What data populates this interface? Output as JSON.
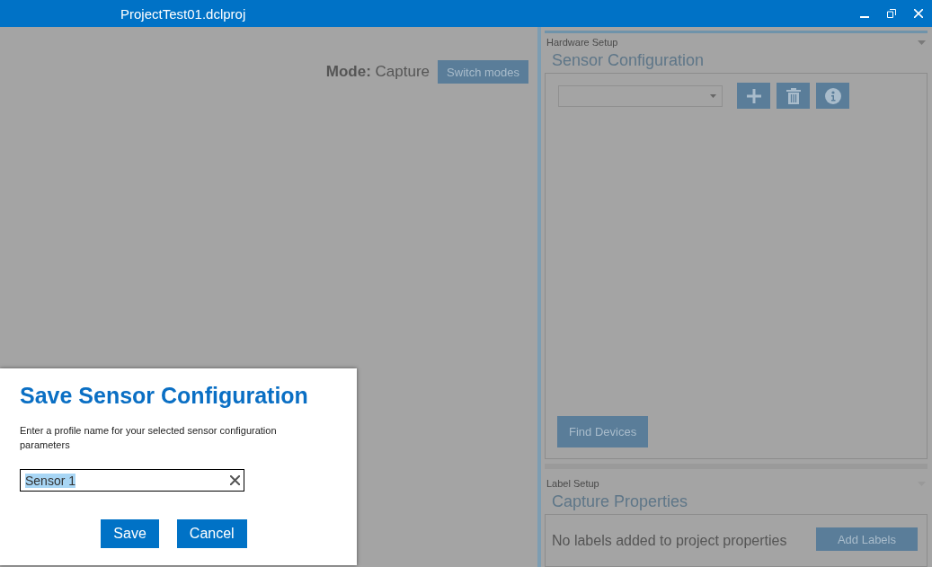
{
  "window": {
    "title": "ProjectTest01.dclproj"
  },
  "mode": {
    "label": "Mode:",
    "value": "Capture",
    "button": "Switch modes"
  },
  "hardware_setup": {
    "header": "Hardware Setup",
    "title": "Sensor Configuration",
    "find_button": "Find Devices"
  },
  "label_setup": {
    "header": "Label Setup",
    "title": "Capture Properties",
    "message": "No labels added to project properties",
    "button": "Add Labels"
  },
  "dialog": {
    "title": "Save Sensor Configuration",
    "message": "Enter a profile name for your selected sensor configuration parameters",
    "field": {
      "value": "Sensor 1",
      "selected": true
    },
    "buttons": [
      "Save",
      "Cancel"
    ]
  }
}
